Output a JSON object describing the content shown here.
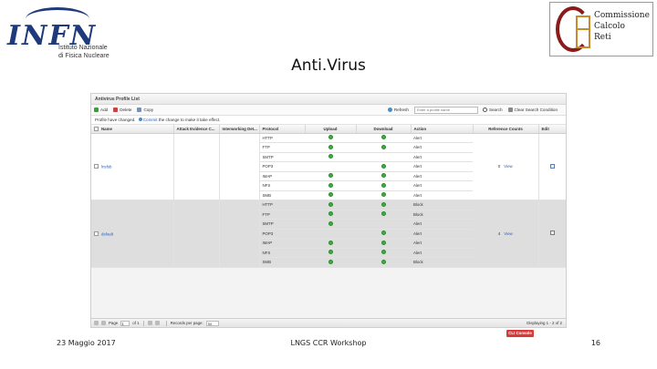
{
  "slide": {
    "title": "Anti.Virus",
    "footer_left": "23 Maggio 2017",
    "footer_center": "LNGS CCR Workshop",
    "footer_right": "16"
  },
  "logos": {
    "infn_text": "INFN",
    "infn_sub1": "Istituto Nazionale",
    "infn_sub2": "di Fisica Nucleare",
    "ccr_line1": "Commissione",
    "ccr_line2": "Calcolo",
    "ccr_line3": "Reti"
  },
  "app": {
    "panel_title": "Antivirus Profile List",
    "toolbar": {
      "add": "Add",
      "delete": "Delete",
      "copy": "Copy",
      "refresh": "Refresh",
      "search_placeholder": "Enter a profile name",
      "search": "Search",
      "clear": "Clear Search Condition"
    },
    "notice_pre": "Profile have changed.",
    "notice_link": "Commit",
    "notice_post": "the change to make it take effect.",
    "columns": [
      "Name",
      "Attack Evidence C...",
      "Interworking Det...",
      "Protocol",
      "Upload",
      "Download",
      "Action",
      "Reference Counts",
      "Edit"
    ],
    "profiles": [
      {
        "name": "lnsfsb",
        "refs": "0",
        "view": "View",
        "rows": [
          {
            "protocol": "HTTP",
            "upload": true,
            "download": true,
            "action": "Alert"
          },
          {
            "protocol": "FTP",
            "upload": true,
            "download": true,
            "action": "Alert"
          },
          {
            "protocol": "SMTP",
            "upload": true,
            "download": false,
            "action": "Alert"
          },
          {
            "protocol": "POP3",
            "upload": false,
            "download": true,
            "action": "Alert"
          },
          {
            "protocol": "IMAP",
            "upload": true,
            "download": true,
            "action": "Alert"
          },
          {
            "protocol": "NFS",
            "upload": true,
            "download": true,
            "action": "Alert"
          },
          {
            "protocol": "SMB",
            "upload": true,
            "download": true,
            "action": "Alert"
          }
        ]
      },
      {
        "name": "default",
        "refs": "4",
        "view": "View",
        "rows": [
          {
            "protocol": "HTTP",
            "upload": true,
            "download": true,
            "action": "Block"
          },
          {
            "protocol": "FTP",
            "upload": true,
            "download": true,
            "action": "Block"
          },
          {
            "protocol": "SMTP",
            "upload": true,
            "download": false,
            "action": "Alert"
          },
          {
            "protocol": "POP3",
            "upload": false,
            "download": true,
            "action": "Alert"
          },
          {
            "protocol": "IMAP",
            "upload": true,
            "download": true,
            "action": "Alert"
          },
          {
            "protocol": "NFS",
            "upload": true,
            "download": true,
            "action": "Alert"
          },
          {
            "protocol": "SMB",
            "upload": true,
            "download": true,
            "action": "Block"
          }
        ]
      }
    ],
    "pager": {
      "page_label": "Page",
      "page_value": "1",
      "of_label": "of 1",
      "records_label": "Records per page:",
      "records_value": "50",
      "displaying": "Displaying 1 - 2 of 2"
    },
    "cli_button": "CLI Console"
  }
}
